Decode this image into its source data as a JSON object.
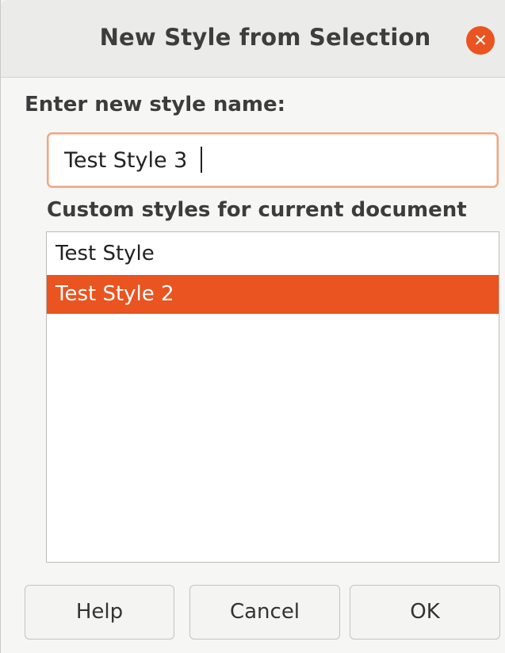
{
  "dialog": {
    "title": "New Style from Selection",
    "close_glyph": "✕"
  },
  "name_field": {
    "label": "Enter new style name:",
    "value": "Test Style 3"
  },
  "custom_styles": {
    "label": "Custom styles for current document",
    "items": [
      {
        "label": "Test Style",
        "selected": false
      },
      {
        "label": "Test Style 2",
        "selected": true
      }
    ]
  },
  "buttons": {
    "help": "Help",
    "cancel": "Cancel",
    "ok": "OK"
  },
  "colors": {
    "accent": "#e95420",
    "focus_border": "#f0a582"
  },
  "icons": {
    "close": "close-icon"
  }
}
